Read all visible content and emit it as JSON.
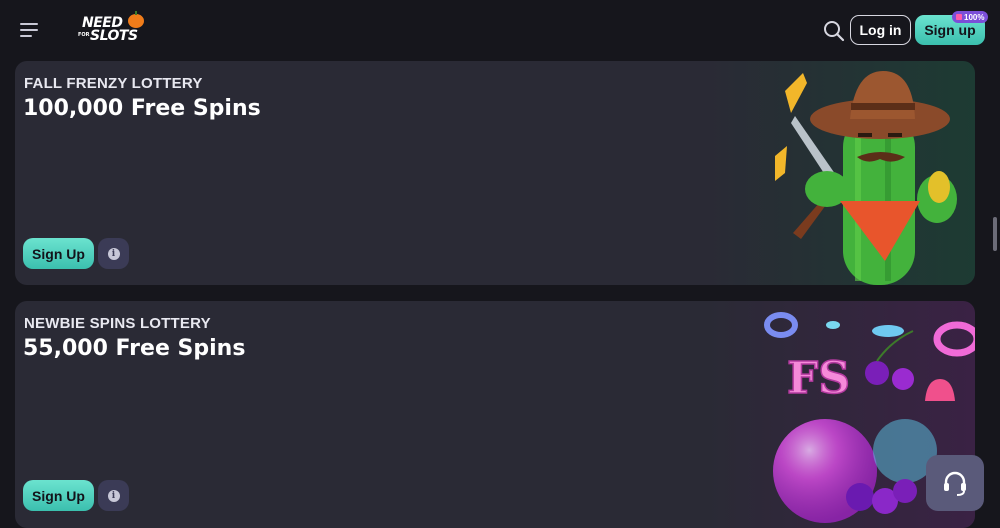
{
  "header": {
    "logo": {
      "line1": "NEED",
      "line2": "SLOTS",
      "line3": "FOR"
    },
    "login_label": "Log in",
    "signup_label": "Sign up",
    "bonus_badge": "100%"
  },
  "cards": [
    {
      "subtitle": "FALL FRENZY LOTTERY",
      "title": "100,000 Free Spins",
      "signup_label": "Sign Up",
      "info_symbol": "i"
    },
    {
      "subtitle": "NEWBIE SPINS LOTTERY",
      "title": "55,000 Free Spins",
      "signup_label": "Sign Up",
      "info_symbol": "i",
      "art_text": "FS"
    }
  ],
  "colors": {
    "accent": "#4fd1c0",
    "background": "#16161c",
    "card": "#2a2a35",
    "info_button": "#3b3b56",
    "badge": "#7b4fd8"
  },
  "icons": {
    "menu": "hamburger-menu-icon",
    "search": "search-icon",
    "info": "info-icon",
    "support": "headset-icon"
  }
}
